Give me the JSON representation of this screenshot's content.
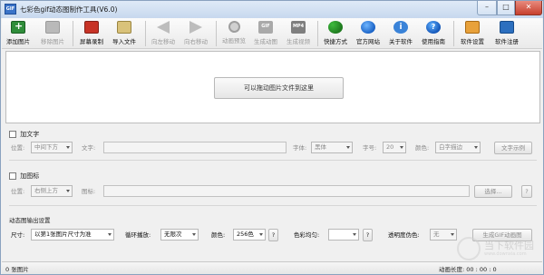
{
  "window": {
    "title": "七彩色gif动态图制作工具(V6.0)",
    "app_icon_text": "GIF",
    "minimize_glyph": "–",
    "maximize_glyph": "□",
    "close_glyph": "✕"
  },
  "toolbar": {
    "items": [
      {
        "label": "添加图片",
        "icon": "add-image-icon",
        "enabled": true
      },
      {
        "label": "移除图片",
        "icon": "remove-image-icon",
        "enabled": false
      },
      {
        "label": "屏幕录制",
        "icon": "screen-record-icon",
        "enabled": true
      },
      {
        "label": "导入文件",
        "icon": "import-file-icon",
        "enabled": true
      },
      {
        "label": "向左移动",
        "icon": "arrow-left-icon",
        "enabled": false
      },
      {
        "label": "向右移动",
        "icon": "arrow-right-icon",
        "enabled": false
      },
      {
        "label": "动画预览",
        "icon": "magnifier-icon",
        "enabled": false
      },
      {
        "label": "生成动图",
        "icon": "gif-icon",
        "enabled": false,
        "icon_text": "GIF"
      },
      {
        "label": "生成视频",
        "icon": "mp4-icon",
        "enabled": false,
        "icon_text": "MP4"
      },
      {
        "label": "快捷方式",
        "icon": "shortcut-icon",
        "enabled": true
      },
      {
        "label": "官方网站",
        "icon": "web-icon",
        "enabled": true
      },
      {
        "label": "关于软件",
        "icon": "info-icon",
        "enabled": true,
        "icon_text": "i"
      },
      {
        "label": "使用指南",
        "icon": "help-icon",
        "enabled": true,
        "icon_text": "?"
      },
      {
        "label": "软件设置",
        "icon": "settings-icon",
        "enabled": true
      },
      {
        "label": "软件注册",
        "icon": "register-icon",
        "enabled": true
      }
    ]
  },
  "drop_area": {
    "button_label": "可以拖动图片文件到这里"
  },
  "text_section": {
    "checkbox_label": "加文字",
    "position_label": "位置:",
    "position_value": "中间下方",
    "text_label": "文字:",
    "font_label": "字体:",
    "font_value": "黑体",
    "size_label": "字号:",
    "size_value": "20",
    "color_label": "颜色:",
    "color_value": "白字描边",
    "preview_button": "文字示例"
  },
  "icon_section": {
    "checkbox_label": "加图标",
    "position_label": "位置:",
    "position_value": "右侧上方",
    "icon_label": "图标:",
    "choose_button": "选择...",
    "help_button": "?"
  },
  "output_section": {
    "title": "动态图输出设置",
    "size_label": "尺寸:",
    "size_value": "以第1张图片尺寸为准",
    "loop_label": "循环播放:",
    "loop_value": "无限次",
    "color_label": "颜色:",
    "color_value": "256色",
    "color_help": "?",
    "uniform_label": "色彩均匀:",
    "uniform_value": "",
    "uniform_help": "?",
    "transparent_label": "透明度伪色:",
    "transparent_value": "无",
    "generate_button": "生成GIF动画图"
  },
  "status": {
    "image_count": "0 张图片",
    "length_label": "动画长度:",
    "length_value": "00 : 00 : 0"
  },
  "watermark": {
    "text": "当下软件园",
    "sub": "www.downxia.com"
  }
}
